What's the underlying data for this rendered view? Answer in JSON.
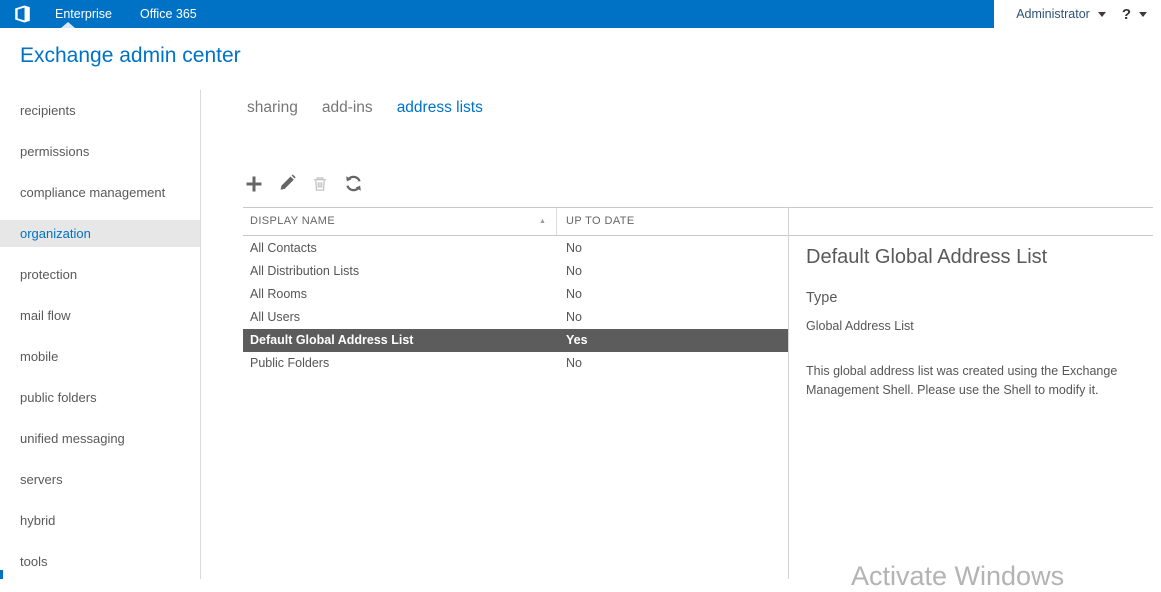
{
  "topbar": {
    "tabs": [
      {
        "label": "Enterprise",
        "selected": true
      },
      {
        "label": "Office 365",
        "selected": false
      }
    ],
    "user_menu_label": "Administrator",
    "help_label": "?"
  },
  "header": {
    "title": "Exchange admin center"
  },
  "sidebar": {
    "items": [
      {
        "label": "recipients",
        "selected": false
      },
      {
        "label": "permissions",
        "selected": false
      },
      {
        "label": "compliance management",
        "selected": false
      },
      {
        "label": "organization",
        "selected": true
      },
      {
        "label": "protection",
        "selected": false
      },
      {
        "label": "mail flow",
        "selected": false
      },
      {
        "label": "mobile",
        "selected": false
      },
      {
        "label": "public folders",
        "selected": false
      },
      {
        "label": "unified messaging",
        "selected": false
      },
      {
        "label": "servers",
        "selected": false
      },
      {
        "label": "hybrid",
        "selected": false
      },
      {
        "label": "tools",
        "selected": false
      }
    ]
  },
  "content_tabs": [
    {
      "label": "sharing",
      "selected": false
    },
    {
      "label": "add-ins",
      "selected": false
    },
    {
      "label": "address lists",
      "selected": true
    }
  ],
  "toolbar": {
    "buttons": [
      {
        "name": "add",
        "icon": "plus-icon",
        "enabled": true
      },
      {
        "name": "edit",
        "icon": "pencil-icon",
        "enabled": true
      },
      {
        "name": "delete",
        "icon": "trash-icon",
        "enabled": false
      },
      {
        "name": "refresh",
        "icon": "refresh-icon",
        "enabled": true
      }
    ]
  },
  "table": {
    "columns": [
      {
        "label": "DISPLAY NAME",
        "sorted": "asc"
      },
      {
        "label": "UP TO DATE",
        "sorted": null
      }
    ],
    "sort_arrow_glyph": "▲",
    "rows": [
      {
        "display_name": "All Contacts",
        "up_to_date": "No",
        "selected": false
      },
      {
        "display_name": "All Distribution Lists",
        "up_to_date": "No",
        "selected": false
      },
      {
        "display_name": "All Rooms",
        "up_to_date": "No",
        "selected": false
      },
      {
        "display_name": "All Users",
        "up_to_date": "No",
        "selected": false
      },
      {
        "display_name": "Default Global Address List",
        "up_to_date": "Yes",
        "selected": true
      },
      {
        "display_name": "Public Folders",
        "up_to_date": "No",
        "selected": false
      }
    ]
  },
  "details": {
    "title": "Default Global Address List",
    "type_label": "Type",
    "type_value": "Global Address List",
    "description": "This global address list was created using the Exchange Management Shell. Please use the Shell to modify it."
  },
  "watermark": "Activate Windows",
  "colors": {
    "accent": "#0072c6",
    "topbar_bg": "#0072c6",
    "selected_row_bg": "#5c5c5c",
    "selected_row_text": "#ffffff",
    "sidebar_selected_bg": "#e7e7e7"
  }
}
